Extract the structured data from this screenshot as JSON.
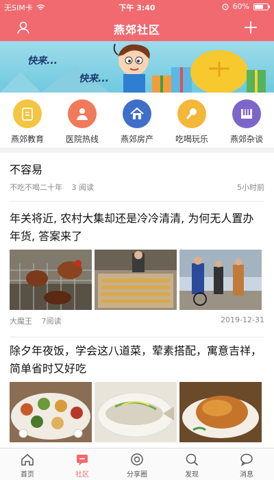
{
  "status_bar": {
    "carrier": "无SIM卡",
    "time": "下午 3:40",
    "battery": "60%"
  },
  "header": {
    "title": "燕郊社区"
  },
  "banner": {
    "text1": "快来...",
    "text2": "快来..."
  },
  "shortcuts": [
    {
      "label": "燕郊教育",
      "icon": "education-icon",
      "color": "#f4c542"
    },
    {
      "label": "医院热线",
      "icon": "doctor-icon",
      "color": "#f07a5a"
    },
    {
      "label": "燕郊房产",
      "icon": "house-icon",
      "color": "#3f6fc9"
    },
    {
      "label": "吃喝玩乐",
      "icon": "microphone-icon",
      "color": "#f4b73a"
    },
    {
      "label": "燕郊杂谈",
      "icon": "piano-icon",
      "color": "#7d66c9"
    }
  ],
  "posts": [
    {
      "title": "不容易",
      "author": "不吃不喝二十年",
      "reads": "3 阅读",
      "time": "5小时前"
    },
    {
      "title": "年关将近, 农村大集却还是冷冷清清, 为何无人置办年货, 答案来了",
      "author": "大魔王",
      "reads": "7阅读",
      "time": "2019-12-31"
    },
    {
      "title": "除夕年夜饭，学会这八道菜，荤素搭配，寓意吉祥，简单省时又好吃"
    }
  ],
  "tabs": [
    {
      "label": "首页",
      "icon": "home-icon"
    },
    {
      "label": "社区",
      "icon": "community-icon",
      "active": true
    },
    {
      "label": "分享圈",
      "icon": "share-circle-icon"
    },
    {
      "label": "发现",
      "icon": "discover-icon"
    },
    {
      "label": "消息",
      "icon": "message-icon"
    }
  ]
}
